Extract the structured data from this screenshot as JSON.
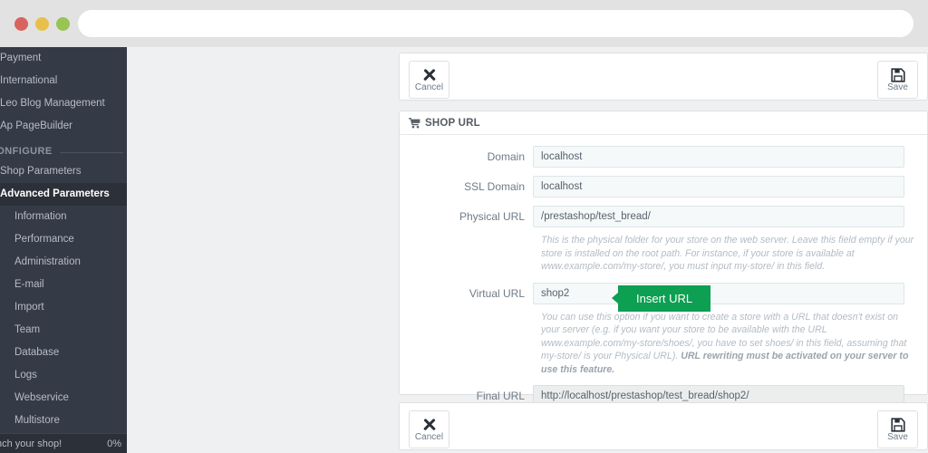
{
  "browser": {
    "url_value": "",
    "url_placeholder": ""
  },
  "sidebar": {
    "items": [
      {
        "label": "Payment",
        "type": "item",
        "active": false
      },
      {
        "label": "International",
        "type": "item",
        "active": false
      },
      {
        "label": "Leo Blog Management",
        "type": "item",
        "active": false
      },
      {
        "label": "Ap PageBuilder",
        "type": "item",
        "active": false
      },
      {
        "label": "CONFIGURE",
        "type": "section",
        "active": false
      },
      {
        "label": "Shop Parameters",
        "type": "item",
        "active": false
      },
      {
        "label": "Advanced Parameters",
        "type": "item",
        "active": true
      },
      {
        "label": "Information",
        "type": "sub",
        "active": false
      },
      {
        "label": "Performance",
        "type": "sub",
        "active": false
      },
      {
        "label": "Administration",
        "type": "sub",
        "active": false
      },
      {
        "label": "E-mail",
        "type": "sub",
        "active": false
      },
      {
        "label": "Import",
        "type": "sub",
        "active": false
      },
      {
        "label": "Team",
        "type": "sub",
        "active": false
      },
      {
        "label": "Database",
        "type": "sub",
        "active": false
      },
      {
        "label": "Logs",
        "type": "sub",
        "active": false
      },
      {
        "label": "Webservice",
        "type": "sub",
        "active": false
      },
      {
        "label": "Multistore",
        "type": "sub",
        "active": false
      }
    ],
    "footer": {
      "label": "nch your shop!",
      "percent": "0%"
    }
  },
  "toolbar": {
    "cancel_label": "Cancel",
    "save_label": "Save",
    "cancel_icon": "close-x-icon",
    "save_icon": "floppy-disk-icon"
  },
  "panel": {
    "title": "SHOP URL",
    "icon": "shopping-cart-icon"
  },
  "form": {
    "domain": {
      "label": "Domain",
      "value": "localhost"
    },
    "ssl_domain": {
      "label": "SSL Domain",
      "value": "localhost"
    },
    "physical_url": {
      "label": "Physical URL",
      "value": "/prestashop/test_bread/",
      "help": "This is the physical folder for your store on the web server. Leave this field empty if your store is installed on the root path. For instance, if your store is available at www.example.com/my-store/, you must input my-store/ in this field."
    },
    "virtual_url": {
      "label": "Virtual URL",
      "value": "shop2",
      "help": "You can use this option if you want to create a store with a URL that doesn't exist on your server (e.g. if you want your store to be available with the URL www.example.com/my-store/shoes/, you have to set shoes/ in this field, assuming that my-store/ is your Physical URL).",
      "help_bold": "URL rewriting must be activated on your server to use this feature."
    },
    "final_url": {
      "label": "Final URL",
      "value": "http://localhost/prestashop/test_bread/shop2/"
    }
  },
  "tooltip": {
    "insert_url_label": "Insert URL"
  },
  "colors": {
    "accent_green": "#0d9f52",
    "sidebar_bg": "#343a46",
    "sidebar_active_bg": "#2b3039",
    "content_bg": "#eff0f2"
  }
}
